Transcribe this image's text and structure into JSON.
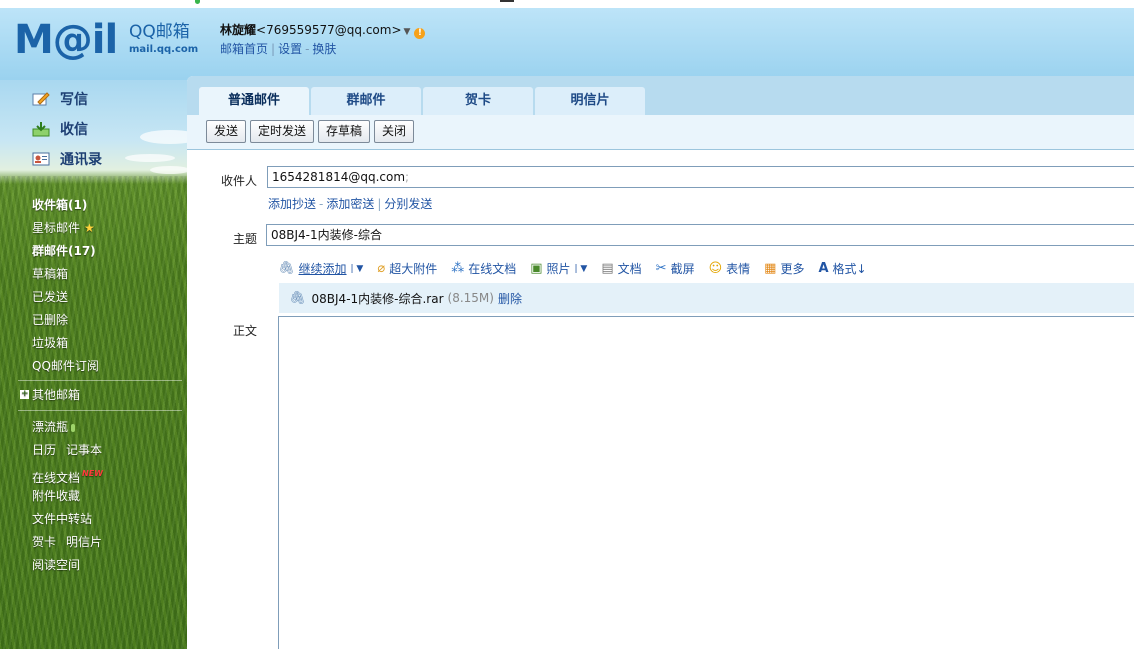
{
  "header": {
    "logo_text": "M@il",
    "logo_name": "QQ邮箱",
    "logo_domain": "mail.qq.com",
    "account_name": "林旋耀",
    "account_email": "<769559577@qq.com>",
    "links": [
      "邮箱首页",
      "设置",
      "换肤"
    ]
  },
  "sidebar": {
    "tools": [
      "写信",
      "收信",
      "通讯录"
    ],
    "folders": [
      "收件箱(1)",
      "星标邮件",
      "群邮件(17)",
      "草稿箱",
      "已发送",
      "已删除",
      "垃圾箱",
      "QQ邮件订阅"
    ],
    "other_mail": "其他邮箱",
    "apps": {
      "bottle": "漂流瓶",
      "calendar": "日历",
      "notebook": "记事本",
      "online_docs": "在线文档",
      "attach_fav": "附件收藏",
      "file_transfer": "文件中转站",
      "card": "贺卡",
      "postcard": "明信片",
      "reading": "阅读空间"
    }
  },
  "compose": {
    "tabs": [
      "普通邮件",
      "群邮件",
      "贺卡",
      "明信片"
    ],
    "buttons": [
      "发送",
      "定时发送",
      "存草稿",
      "关闭"
    ],
    "to_label": "收件人",
    "to_value": "1654281814@qq.com",
    "to_sep": ";",
    "cc_links": [
      "添加抄送",
      "添加密送",
      "分别发送"
    ],
    "subject_label": "主题",
    "subject_value": "08BJ4-1内装修-综合",
    "toolbar": {
      "add_more": "继续添加",
      "big_attach": "超大附件",
      "online_doc": "在线文档",
      "photo": "照片",
      "doc": "文档",
      "screenshot": "截屏",
      "emoji": "表情",
      "more": "更多",
      "format": "格式↓"
    },
    "attachment": {
      "name": "08BJ4-1内装修-综合.rar",
      "size": "(8.15M)",
      "delete": "删除"
    },
    "body_label": "正文"
  }
}
